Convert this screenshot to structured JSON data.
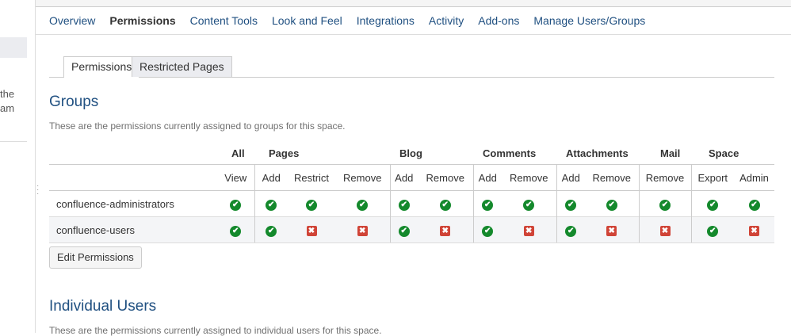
{
  "left_panel": {
    "fragment_1": "the",
    "fragment_2": "am"
  },
  "nav": {
    "tabs": [
      "Overview",
      "Permissions",
      "Content Tools",
      "Look and Feel",
      "Integrations",
      "Activity",
      "Add-ons",
      "Manage Users/Groups"
    ],
    "active": "Permissions"
  },
  "subtabs": {
    "permissions": "Permissions",
    "restricted": "Restricted Pages"
  },
  "groups": {
    "title": "Groups",
    "description": "These are the permissions currently assigned to groups for this space.",
    "header_groups": [
      "All",
      "Pages",
      "Blog",
      "Comments",
      "Attachments",
      "Mail",
      "Space"
    ],
    "columns": [
      "View",
      "Add",
      "Restrict",
      "Remove",
      "Add",
      "Remove",
      "Add",
      "Remove",
      "Add",
      "Remove",
      "Remove",
      "Export",
      "Admin"
    ],
    "rows": [
      {
        "name": "confluence-administrators",
        "perms": [
          true,
          true,
          true,
          true,
          true,
          true,
          true,
          true,
          true,
          true,
          true,
          true,
          true
        ]
      },
      {
        "name": "confluence-users",
        "perms": [
          true,
          true,
          false,
          false,
          true,
          false,
          true,
          false,
          true,
          false,
          false,
          true,
          false
        ]
      }
    ],
    "edit_button": "Edit Permissions"
  },
  "users": {
    "title": "Individual Users",
    "description": "These are the permissions currently assigned to individual users for this space."
  },
  "colors": {
    "link": "#205081",
    "granted": "#14892c",
    "denied": "#d04437"
  }
}
